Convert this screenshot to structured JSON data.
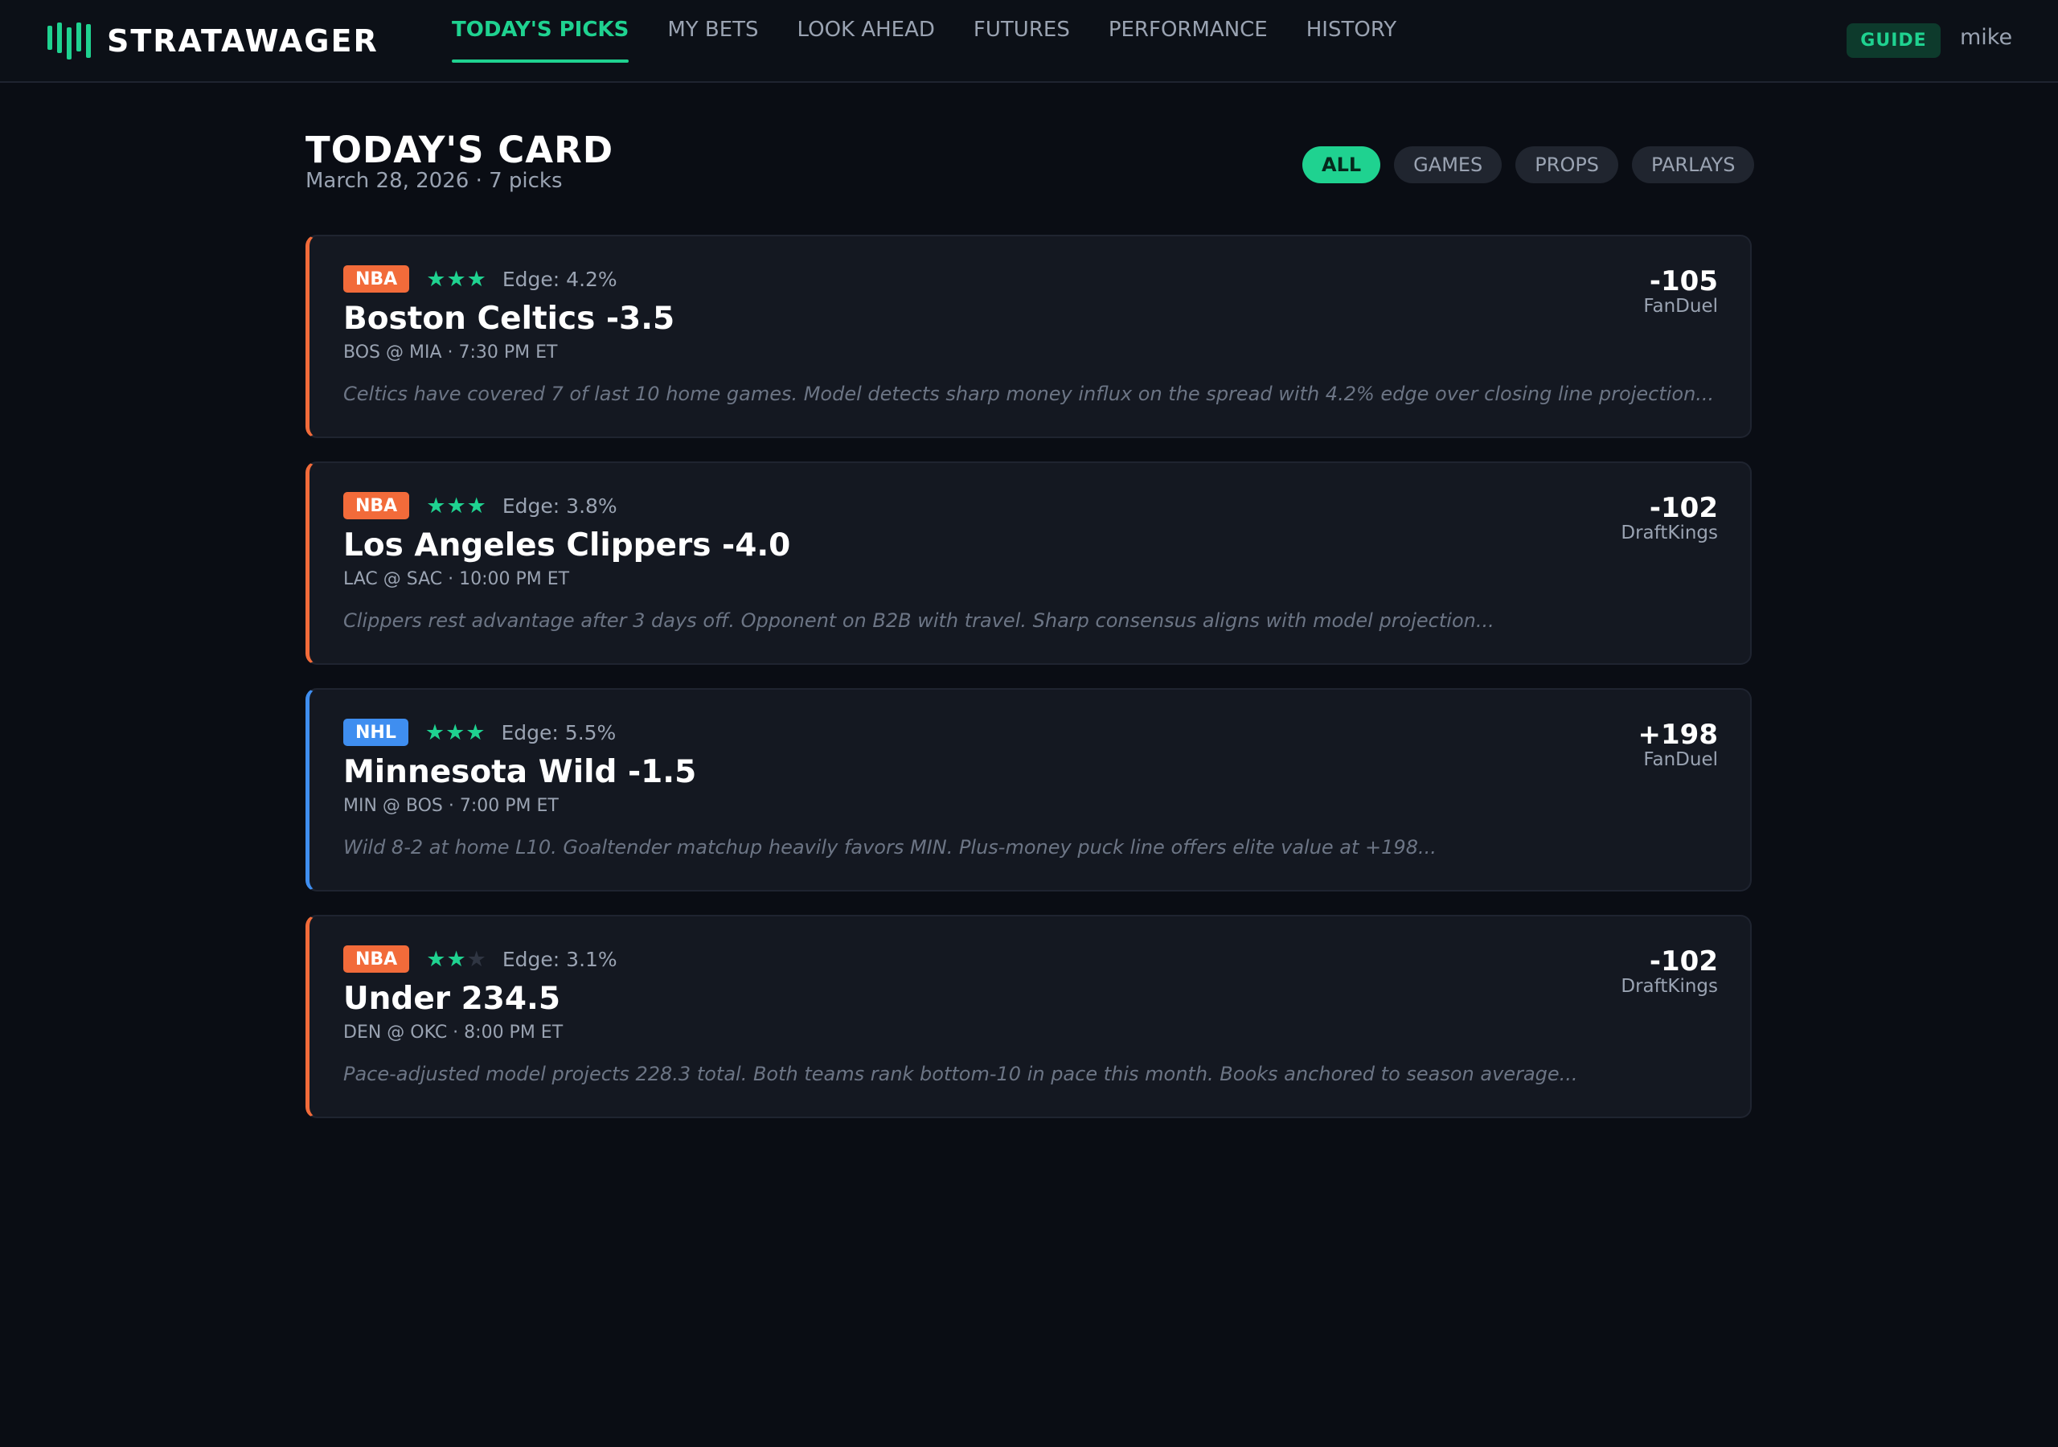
{
  "brand": {
    "name": "STRATAWAGER",
    "accent": "#1fd290"
  },
  "nav": {
    "tabs": [
      {
        "label": "TODAY'S PICKS",
        "active": true
      },
      {
        "label": "MY BETS",
        "active": false
      },
      {
        "label": "LOOK AHEAD",
        "active": false
      },
      {
        "label": "FUTURES",
        "active": false
      },
      {
        "label": "PERFORMANCE",
        "active": false
      },
      {
        "label": "HISTORY",
        "active": false
      }
    ],
    "guide_label": "GUIDE",
    "username": "mike"
  },
  "header": {
    "title": "TODAY'S CARD",
    "subtitle": "March 28, 2026 · 7 picks"
  },
  "filters": [
    {
      "label": "ALL",
      "active": true
    },
    {
      "label": "GAMES",
      "active": false
    },
    {
      "label": "PROPS",
      "active": false
    },
    {
      "label": "PARLAYS",
      "active": false
    }
  ],
  "league_colors": {
    "NBA": "#f26b3a",
    "NHL": "#3f8ef0"
  },
  "picks": [
    {
      "league": "NBA",
      "stars": 3,
      "stars_max": 3,
      "edge": "Edge: 4.2%",
      "title": "Boston Celtics -3.5",
      "matchup": "BOS @ MIA · 7:30 PM ET",
      "analysis": "Celtics have covered 7 of last 10 home games. Model detects sharp money influx on the spread with 4.2% edge over closing line projection...",
      "odds": "-105",
      "book": "FanDuel"
    },
    {
      "league": "NBA",
      "stars": 3,
      "stars_max": 3,
      "edge": "Edge: 3.8%",
      "title": "Los Angeles Clippers -4.0",
      "matchup": "LAC @ SAC · 10:00 PM ET",
      "analysis": "Clippers rest advantage after 3 days off. Opponent on B2B with travel. Sharp consensus aligns with model projection...",
      "odds": "-102",
      "book": "DraftKings"
    },
    {
      "league": "NHL",
      "stars": 3,
      "stars_max": 3,
      "edge": "Edge: 5.5%",
      "title": "Minnesota Wild -1.5",
      "matchup": "MIN @ BOS · 7:00 PM ET",
      "analysis": "Wild 8-2 at home L10. Goaltender matchup heavily favors MIN. Plus-money puck line offers elite value at +198...",
      "odds": "+198",
      "book": "FanDuel"
    },
    {
      "league": "NBA",
      "stars": 2,
      "stars_max": 3,
      "edge": "Edge: 3.1%",
      "title": "Under 234.5",
      "matchup": "DEN @ OKC · 8:00 PM ET",
      "analysis": "Pace-adjusted model projects 228.3 total. Both teams rank bottom-10 in pace this month. Books anchored to season average...",
      "odds": "-102",
      "book": "DraftKings"
    }
  ]
}
